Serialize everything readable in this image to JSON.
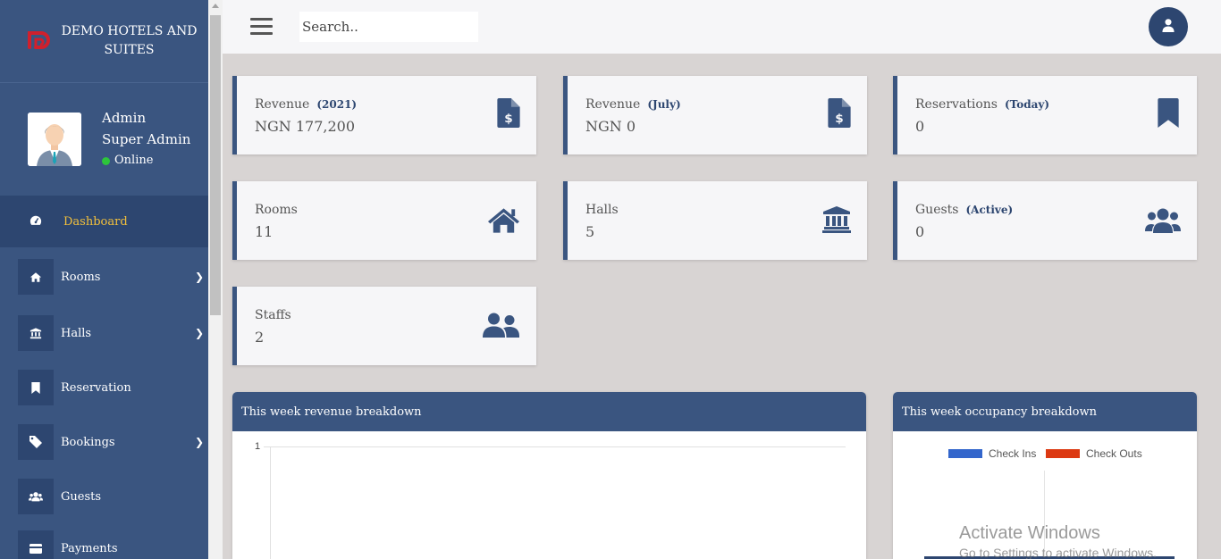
{
  "brand": {
    "name": "DEMO HOTELS AND SUITES"
  },
  "profile": {
    "name": "Admin",
    "role": "Super Admin",
    "status": "Online"
  },
  "nav": {
    "dashboard": "Dashboard",
    "rooms": "Rooms",
    "halls": "Halls",
    "reservation": "Reservation",
    "bookings": "Bookings",
    "guests": "Guests",
    "payments": "Payments"
  },
  "search": {
    "placeholder": "Search.."
  },
  "cards": {
    "revenue_year": {
      "title": "Revenue",
      "sub": "(2021)",
      "value": "NGN 177,200",
      "icon": "invoice-dollar-icon"
    },
    "revenue_month": {
      "title": "Revenue",
      "sub": "(July)",
      "value": "NGN 0",
      "icon": "invoice-dollar-icon"
    },
    "reservations": {
      "title": "Reservations",
      "sub": "(Today)",
      "value": "0",
      "icon": "bookmark-icon"
    },
    "rooms": {
      "title": "Rooms",
      "value": "11",
      "icon": "home-icon"
    },
    "halls": {
      "title": "Halls",
      "value": "5",
      "icon": "landmark-icon"
    },
    "guests": {
      "title": "Guests",
      "sub": "(Active)",
      "value": "0",
      "icon": "users-icon"
    },
    "staffs": {
      "title": "Staffs",
      "value": "2",
      "icon": "user-friends-icon"
    }
  },
  "panels": {
    "revenue": {
      "title": "This week revenue breakdown",
      "y_tick": "1"
    },
    "occupancy": {
      "title": "This week occupancy breakdown",
      "legend": [
        "Check Ins",
        "Check Outs"
      ]
    }
  },
  "colors": {
    "primary": "#3a5580",
    "dark": "#2d4670",
    "accent": "#f2c03c",
    "check_ins": "#3366cc",
    "check_outs": "#dc3912"
  },
  "watermark": {
    "line1": "Activate Windows",
    "line2": "Go to Settings to activate Windows."
  }
}
